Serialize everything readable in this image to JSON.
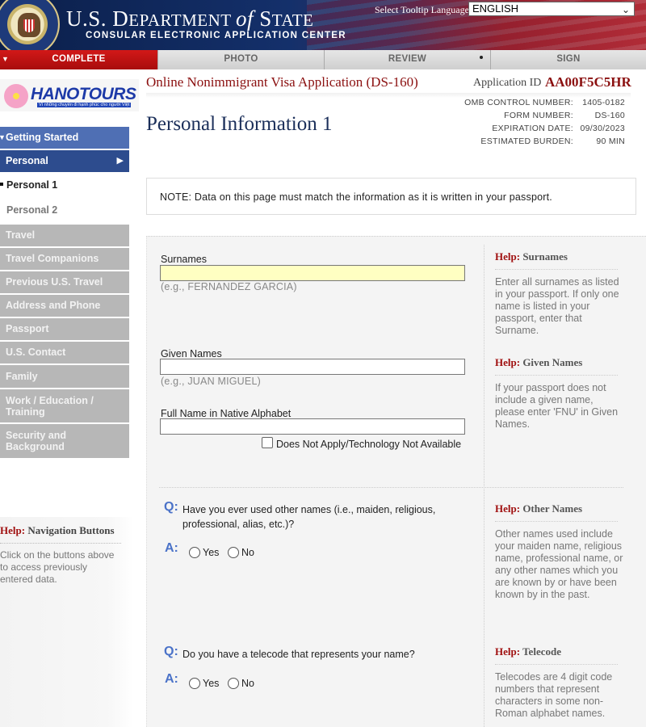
{
  "banner": {
    "dept_title": "U.S. Department of State",
    "dept_title_prefix": "U.S. D",
    "dept_title_mid": "EPARTMENT ",
    "dept_title_of": "of",
    "dept_title_end": " S",
    "dept_title_tail": "TATE",
    "subtitle": "CONSULAR ELECTRONIC APPLICATION CENTER",
    "tooltip_language_label": "Select Tooltip Language",
    "tooltip_language_value": "ENGLISH"
  },
  "progress": {
    "tabs": [
      {
        "label": "COMPLETE",
        "active": true
      },
      {
        "label": "PHOTO"
      },
      {
        "label": "REVIEW"
      },
      {
        "label": "SIGN"
      }
    ]
  },
  "logo": {
    "brand": "HANOTOURS",
    "tagline": "Vì những chuyến đi hạnh phúc cho người Việt"
  },
  "sidebar": {
    "items": [
      {
        "label": "Getting Started"
      },
      {
        "label": "Personal"
      },
      {
        "label": "Personal 1"
      },
      {
        "label": "Personal 2"
      },
      {
        "label": "Travel"
      },
      {
        "label": "Travel Companions"
      },
      {
        "label": "Previous U.S. Travel"
      },
      {
        "label": "Address and Phone"
      },
      {
        "label": "Passport"
      },
      {
        "label": "U.S. Contact"
      },
      {
        "label": "Family"
      },
      {
        "label": "Work / Education / Training"
      },
      {
        "label": "Security and Background"
      }
    ],
    "help": {
      "prefix": "Help:",
      "title": "Navigation Buttons",
      "text": "Click on the buttons above to access previously entered data."
    }
  },
  "header": {
    "app_title": "Online Nonimmigrant Visa Application (DS-160)",
    "app_id_label": "Application ID",
    "app_id": "AA00F5C5HR",
    "page_title": "Personal Information 1",
    "omb": [
      {
        "k": "OMB CONTROL NUMBER:",
        "v": "1405-0182"
      },
      {
        "k": "FORM NUMBER:",
        "v": "DS-160"
      },
      {
        "k": "EXPIRATION DATE:",
        "v": "09/30/2023"
      },
      {
        "k": "ESTIMATED BURDEN:",
        "v": "90 MIN"
      }
    ]
  },
  "note": "NOTE: Data on this page must match the information as it is written in your passport.",
  "form": {
    "surnames_label": "Surnames",
    "surnames_value": "",
    "surnames_hint": "(e.g., FERNANDEZ GARCIA)",
    "given_label": "Given Names",
    "given_value": "",
    "given_hint": "(e.g., JUAN MIGUEL)",
    "native_label": "Full Name in Native Alphabet",
    "native_value": "",
    "native_na_label": "Does Not Apply/Technology Not Available",
    "q_letter": "Q:",
    "a_letter": "A:",
    "q1": "Have you ever used other names (i.e., maiden, religious, professional, alias, etc.)?",
    "q2": "Do you have a telecode that represents your name?",
    "yes": "Yes",
    "no": "No"
  },
  "help": {
    "prefix": "Help:",
    "surnames_title": "Surnames",
    "surnames_text": "Enter all surnames as listed in your passport. If only one name is listed in your passport, enter that Surname.",
    "given_title": "Given Names",
    "given_text": "If your passport does not include a given name, please enter 'FNU' in Given Names.",
    "other_title": "Other Names",
    "other_text": "Other names used include your maiden name, religious name, professional name, or any other names which you are known by or have been known by in the past.",
    "telecode_title": "Telecode",
    "telecode_text": "Telecodes are 4 digit code numbers that represent characters in some non-Roman alphabet names."
  }
}
